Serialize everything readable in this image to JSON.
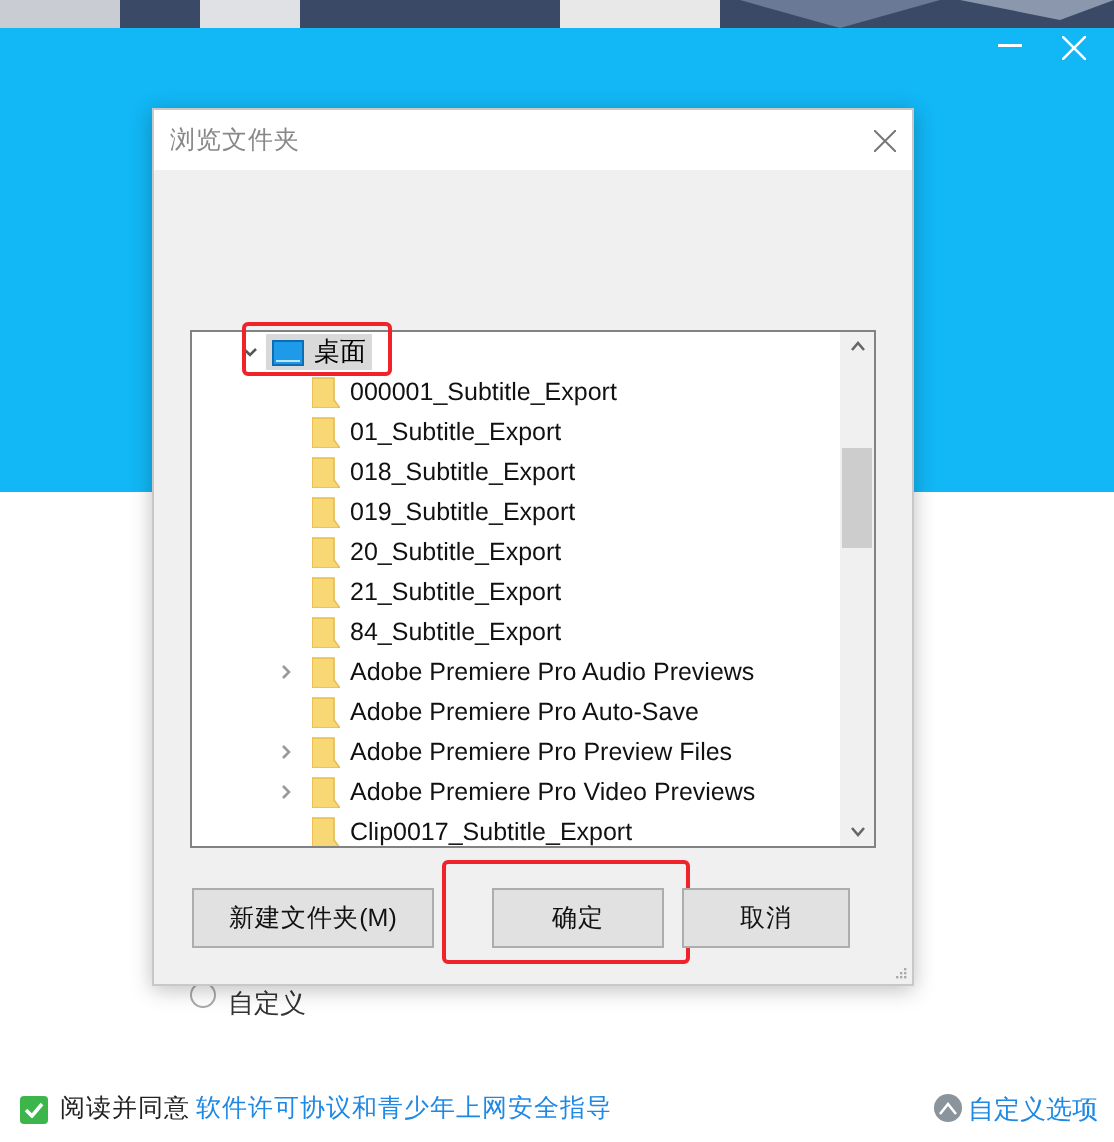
{
  "installer": {
    "agreement": {
      "checked": true,
      "prefix": "阅读并同意",
      "link": "软件许可协议和青少年上网安全指导"
    },
    "custom_option": {
      "selected": false,
      "label": "自定义"
    },
    "custom_link": "自定义选项"
  },
  "dialog": {
    "title": "浏览文件夹",
    "tree": [
      {
        "label": "桌面",
        "kind": "desktop",
        "expanded": true,
        "selected": true,
        "children": [
          {
            "label": "000001_Subtitle_Export",
            "has_children": false
          },
          {
            "label": "01_Subtitle_Export",
            "has_children": false
          },
          {
            "label": "018_Subtitle_Export",
            "has_children": false
          },
          {
            "label": "019_Subtitle_Export",
            "has_children": false
          },
          {
            "label": "20_Subtitle_Export",
            "has_children": false
          },
          {
            "label": "21_Subtitle_Export",
            "has_children": false
          },
          {
            "label": "84_Subtitle_Export",
            "has_children": false
          },
          {
            "label": "Adobe Premiere Pro Audio Previews",
            "has_children": true
          },
          {
            "label": "Adobe Premiere Pro Auto-Save",
            "has_children": false
          },
          {
            "label": "Adobe Premiere Pro Preview Files",
            "has_children": true
          },
          {
            "label": "Adobe Premiere Pro Video Previews",
            "has_children": true
          },
          {
            "label": "Clip0017_Subtitle_Export",
            "has_children": false
          }
        ]
      }
    ],
    "buttons": [
      {
        "label": "新建文件夹(M)",
        "highlighted": false
      },
      {
        "label": "确定",
        "highlighted": true
      },
      {
        "label": "取消",
        "highlighted": false
      }
    ]
  }
}
